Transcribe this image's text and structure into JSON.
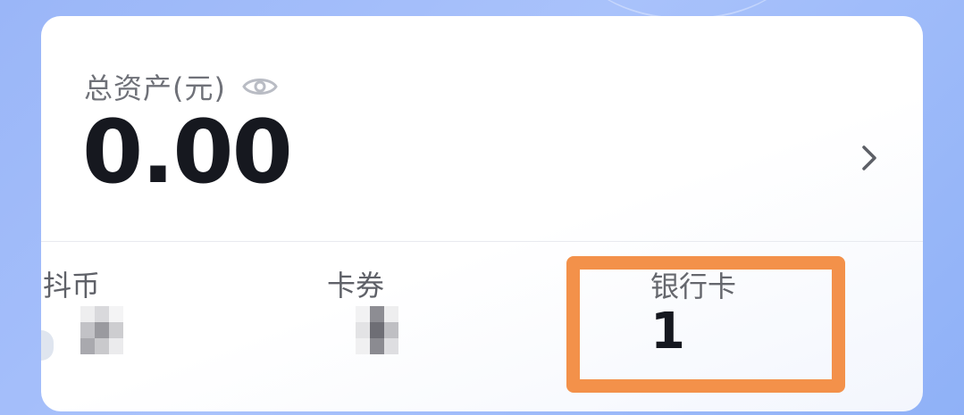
{
  "wallet": {
    "total_label": "总资产(元)",
    "total_amount": "0.00",
    "stats": [
      {
        "label": "抖币",
        "value": ""
      },
      {
        "label": "卡券",
        "value": ""
      },
      {
        "label": "银行卡",
        "value": "1"
      }
    ]
  },
  "icons": {
    "visibility": "eye-icon",
    "detail": "chevron-right-icon"
  },
  "colors": {
    "highlight": "#f3914a",
    "amount_text": "#16181f",
    "label_text": "#6f7178"
  }
}
